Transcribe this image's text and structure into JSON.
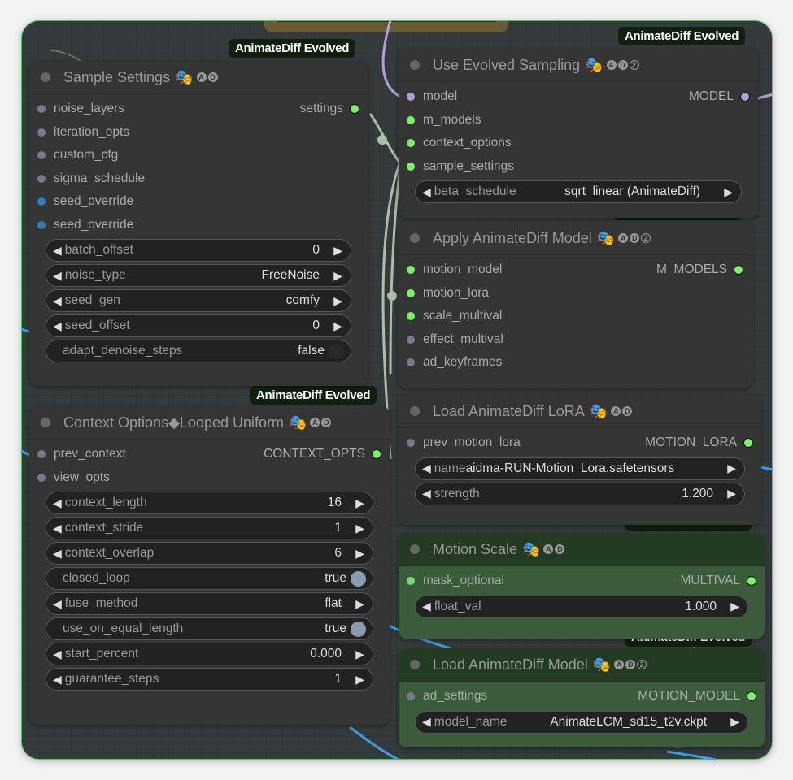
{
  "colors": {
    "accent_frame": "#56c26a",
    "slot_green": "#7cf26a",
    "slot_purple": "#b39ddb",
    "slot_gray": "#7a7890",
    "slot_blue": "#2f7ebf",
    "link_blue": "#3d9be8",
    "link_gray": "#a9bfa6",
    "link_purple": "#b39ddb"
  },
  "tag_label": "AnimateDiff Evolved",
  "nodes": {
    "sample_settings": {
      "title": "Sample Settings",
      "badges": [
        "A",
        "D"
      ],
      "inputs": [
        {
          "name": "noise_layers",
          "type": "gray"
        },
        {
          "name": "iteration_opts",
          "type": "gray"
        },
        {
          "name": "custom_cfg",
          "type": "gray"
        },
        {
          "name": "sigma_schedule",
          "type": "gray"
        },
        {
          "name": "seed_override",
          "type": "blue"
        },
        {
          "name": "seed_override",
          "type": "blue"
        }
      ],
      "output": "settings",
      "widgets": [
        {
          "label": "batch_offset",
          "value": "0"
        },
        {
          "label": "noise_type",
          "value": "FreeNoise"
        },
        {
          "label": "seed_gen",
          "value": "comfy"
        },
        {
          "label": "seed_offset",
          "value": "0"
        },
        {
          "label": "adapt_denoise_steps",
          "value": "false",
          "toggle": true,
          "on": false
        }
      ]
    },
    "context_options": {
      "title": "Context Options◆Looped Uniform",
      "badges": [
        "A",
        "D"
      ],
      "inputs": [
        {
          "name": "prev_context",
          "type": "gray"
        },
        {
          "name": "view_opts",
          "type": "gray"
        }
      ],
      "output": "CONTEXT_OPTS",
      "widgets": [
        {
          "label": "context_length",
          "value": "16"
        },
        {
          "label": "context_stride",
          "value": "1"
        },
        {
          "label": "context_overlap",
          "value": "6"
        },
        {
          "label": "closed_loop",
          "value": "true",
          "toggle": true,
          "on": true
        },
        {
          "label": "fuse_method",
          "value": "flat"
        },
        {
          "label": "use_on_equal_length",
          "value": "true",
          "toggle": true,
          "on": true
        },
        {
          "label": "start_percent",
          "value": "0.000"
        },
        {
          "label": "guarantee_steps",
          "value": "1"
        }
      ]
    },
    "use_evolved_sampling": {
      "title": "Use Evolved Sampling",
      "badges": [
        "A",
        "D",
        "2"
      ],
      "inputs": [
        {
          "name": "model",
          "type": "purple"
        },
        {
          "name": "m_models",
          "type": "green"
        },
        {
          "name": "context_options",
          "type": "green"
        },
        {
          "name": "sample_settings",
          "type": "green"
        }
      ],
      "output": "MODEL",
      "widgets": [
        {
          "label": "beta_schedule",
          "value": "sqrt_linear (AnimateDiff)"
        }
      ]
    },
    "apply_animatediff_model": {
      "title": "Apply AnimateDiff Model",
      "badges": [
        "A",
        "D",
        "2"
      ],
      "inputs": [
        {
          "name": "motion_model",
          "type": "green"
        },
        {
          "name": "motion_lora",
          "type": "green"
        },
        {
          "name": "scale_multival",
          "type": "green"
        },
        {
          "name": "effect_multival",
          "type": "gray"
        },
        {
          "name": "ad_keyframes",
          "type": "gray"
        }
      ],
      "output": "M_MODELS",
      "widgets": []
    },
    "load_animatediff_lora": {
      "title": "Load AnimateDiff LoRA",
      "badges": [
        "A",
        "D"
      ],
      "inputs": [
        {
          "name": "prev_motion_lora",
          "type": "gray"
        }
      ],
      "output": "MOTION_LORA",
      "widgets": [
        {
          "label": "name",
          "value": "aidma-RUN-Motion_Lora.safetensors"
        },
        {
          "label": "strength",
          "value": "1.200"
        }
      ]
    },
    "motion_scale": {
      "title": "Motion Scale",
      "badges": [
        "A",
        "D"
      ],
      "inputs": [
        {
          "name": "mask_optional",
          "type": "lightgreen"
        }
      ],
      "output": "MULTIVAL",
      "widgets": [
        {
          "label": "float_val",
          "value": "1.000"
        }
      ]
    },
    "load_animatediff_model": {
      "title": "Load AnimateDiff Model",
      "badges": [
        "A",
        "D",
        "2"
      ],
      "inputs": [
        {
          "name": "ad_settings",
          "type": "gray"
        }
      ],
      "output": "MOTION_MODEL",
      "widgets": [
        {
          "label": "model_name",
          "value": "AnimateLCM_sd15_t2v.ckpt"
        }
      ]
    }
  }
}
